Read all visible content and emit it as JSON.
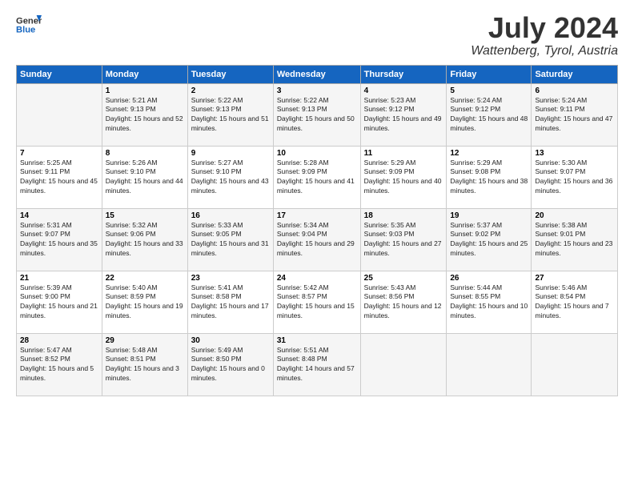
{
  "header": {
    "logo_line1": "General",
    "logo_line2": "Blue",
    "month_year": "July 2024",
    "location": "Wattenberg, Tyrol, Austria"
  },
  "columns": [
    "Sunday",
    "Monday",
    "Tuesday",
    "Wednesday",
    "Thursday",
    "Friday",
    "Saturday"
  ],
  "weeks": [
    [
      {
        "day": "",
        "sunrise": "",
        "sunset": "",
        "daylight": ""
      },
      {
        "day": "1",
        "sunrise": "Sunrise: 5:21 AM",
        "sunset": "Sunset: 9:13 PM",
        "daylight": "Daylight: 15 hours and 52 minutes."
      },
      {
        "day": "2",
        "sunrise": "Sunrise: 5:22 AM",
        "sunset": "Sunset: 9:13 PM",
        "daylight": "Daylight: 15 hours and 51 minutes."
      },
      {
        "day": "3",
        "sunrise": "Sunrise: 5:22 AM",
        "sunset": "Sunset: 9:13 PM",
        "daylight": "Daylight: 15 hours and 50 minutes."
      },
      {
        "day": "4",
        "sunrise": "Sunrise: 5:23 AM",
        "sunset": "Sunset: 9:12 PM",
        "daylight": "Daylight: 15 hours and 49 minutes."
      },
      {
        "day": "5",
        "sunrise": "Sunrise: 5:24 AM",
        "sunset": "Sunset: 9:12 PM",
        "daylight": "Daylight: 15 hours and 48 minutes."
      },
      {
        "day": "6",
        "sunrise": "Sunrise: 5:24 AM",
        "sunset": "Sunset: 9:11 PM",
        "daylight": "Daylight: 15 hours and 47 minutes."
      }
    ],
    [
      {
        "day": "7",
        "sunrise": "Sunrise: 5:25 AM",
        "sunset": "Sunset: 9:11 PM",
        "daylight": "Daylight: 15 hours and 45 minutes."
      },
      {
        "day": "8",
        "sunrise": "Sunrise: 5:26 AM",
        "sunset": "Sunset: 9:10 PM",
        "daylight": "Daylight: 15 hours and 44 minutes."
      },
      {
        "day": "9",
        "sunrise": "Sunrise: 5:27 AM",
        "sunset": "Sunset: 9:10 PM",
        "daylight": "Daylight: 15 hours and 43 minutes."
      },
      {
        "day": "10",
        "sunrise": "Sunrise: 5:28 AM",
        "sunset": "Sunset: 9:09 PM",
        "daylight": "Daylight: 15 hours and 41 minutes."
      },
      {
        "day": "11",
        "sunrise": "Sunrise: 5:29 AM",
        "sunset": "Sunset: 9:09 PM",
        "daylight": "Daylight: 15 hours and 40 minutes."
      },
      {
        "day": "12",
        "sunrise": "Sunrise: 5:29 AM",
        "sunset": "Sunset: 9:08 PM",
        "daylight": "Daylight: 15 hours and 38 minutes."
      },
      {
        "day": "13",
        "sunrise": "Sunrise: 5:30 AM",
        "sunset": "Sunset: 9:07 PM",
        "daylight": "Daylight: 15 hours and 36 minutes."
      }
    ],
    [
      {
        "day": "14",
        "sunrise": "Sunrise: 5:31 AM",
        "sunset": "Sunset: 9:07 PM",
        "daylight": "Daylight: 15 hours and 35 minutes."
      },
      {
        "day": "15",
        "sunrise": "Sunrise: 5:32 AM",
        "sunset": "Sunset: 9:06 PM",
        "daylight": "Daylight: 15 hours and 33 minutes."
      },
      {
        "day": "16",
        "sunrise": "Sunrise: 5:33 AM",
        "sunset": "Sunset: 9:05 PM",
        "daylight": "Daylight: 15 hours and 31 minutes."
      },
      {
        "day": "17",
        "sunrise": "Sunrise: 5:34 AM",
        "sunset": "Sunset: 9:04 PM",
        "daylight": "Daylight: 15 hours and 29 minutes."
      },
      {
        "day": "18",
        "sunrise": "Sunrise: 5:35 AM",
        "sunset": "Sunset: 9:03 PM",
        "daylight": "Daylight: 15 hours and 27 minutes."
      },
      {
        "day": "19",
        "sunrise": "Sunrise: 5:37 AM",
        "sunset": "Sunset: 9:02 PM",
        "daylight": "Daylight: 15 hours and 25 minutes."
      },
      {
        "day": "20",
        "sunrise": "Sunrise: 5:38 AM",
        "sunset": "Sunset: 9:01 PM",
        "daylight": "Daylight: 15 hours and 23 minutes."
      }
    ],
    [
      {
        "day": "21",
        "sunrise": "Sunrise: 5:39 AM",
        "sunset": "Sunset: 9:00 PM",
        "daylight": "Daylight: 15 hours and 21 minutes."
      },
      {
        "day": "22",
        "sunrise": "Sunrise: 5:40 AM",
        "sunset": "Sunset: 8:59 PM",
        "daylight": "Daylight: 15 hours and 19 minutes."
      },
      {
        "day": "23",
        "sunrise": "Sunrise: 5:41 AM",
        "sunset": "Sunset: 8:58 PM",
        "daylight": "Daylight: 15 hours and 17 minutes."
      },
      {
        "day": "24",
        "sunrise": "Sunrise: 5:42 AM",
        "sunset": "Sunset: 8:57 PM",
        "daylight": "Daylight: 15 hours and 15 minutes."
      },
      {
        "day": "25",
        "sunrise": "Sunrise: 5:43 AM",
        "sunset": "Sunset: 8:56 PM",
        "daylight": "Daylight: 15 hours and 12 minutes."
      },
      {
        "day": "26",
        "sunrise": "Sunrise: 5:44 AM",
        "sunset": "Sunset: 8:55 PM",
        "daylight": "Daylight: 15 hours and 10 minutes."
      },
      {
        "day": "27",
        "sunrise": "Sunrise: 5:46 AM",
        "sunset": "Sunset: 8:54 PM",
        "daylight": "Daylight: 15 hours and 7 minutes."
      }
    ],
    [
      {
        "day": "28",
        "sunrise": "Sunrise: 5:47 AM",
        "sunset": "Sunset: 8:52 PM",
        "daylight": "Daylight: 15 hours and 5 minutes."
      },
      {
        "day": "29",
        "sunrise": "Sunrise: 5:48 AM",
        "sunset": "Sunset: 8:51 PM",
        "daylight": "Daylight: 15 hours and 3 minutes."
      },
      {
        "day": "30",
        "sunrise": "Sunrise: 5:49 AM",
        "sunset": "Sunset: 8:50 PM",
        "daylight": "Daylight: 15 hours and 0 minutes."
      },
      {
        "day": "31",
        "sunrise": "Sunrise: 5:51 AM",
        "sunset": "Sunset: 8:48 PM",
        "daylight": "Daylight: 14 hours and 57 minutes."
      },
      {
        "day": "",
        "sunrise": "",
        "sunset": "",
        "daylight": ""
      },
      {
        "day": "",
        "sunrise": "",
        "sunset": "",
        "daylight": ""
      },
      {
        "day": "",
        "sunrise": "",
        "sunset": "",
        "daylight": ""
      }
    ]
  ]
}
